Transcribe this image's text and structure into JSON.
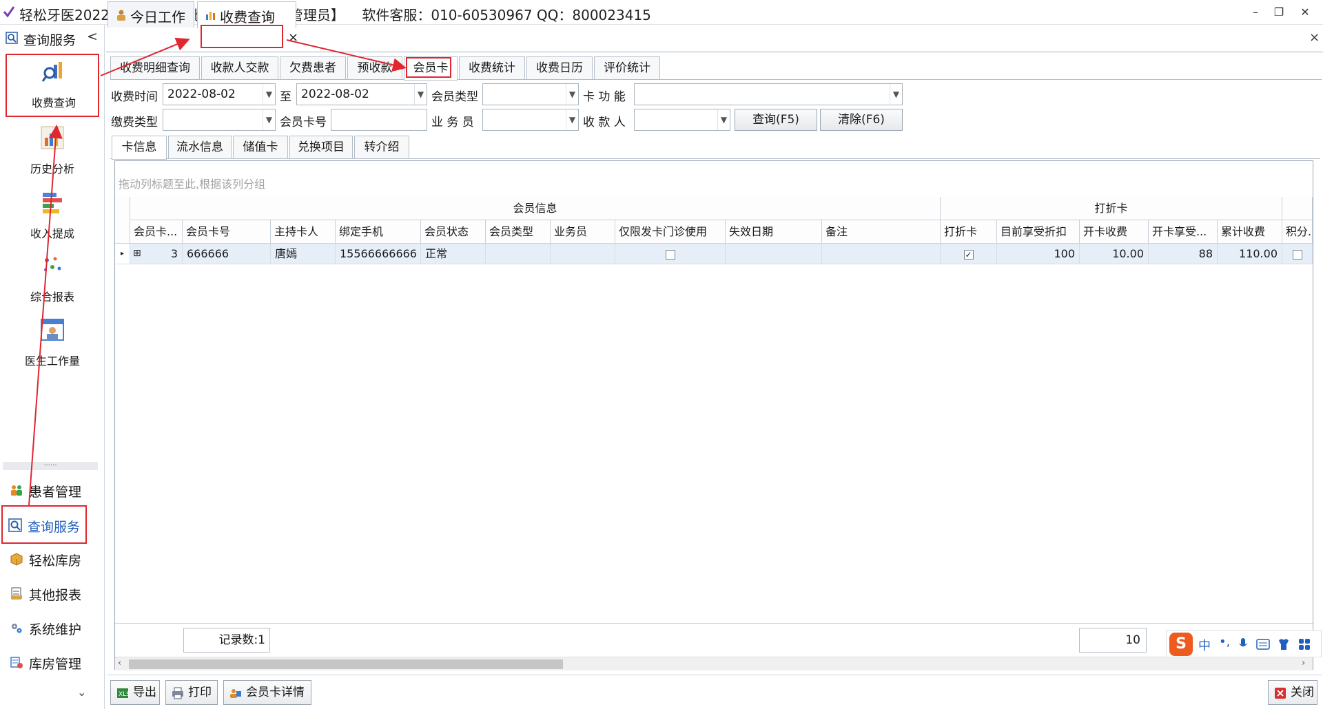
{
  "title_bar": {
    "title": "轻松牙医2022版S4专业版(北京轻松牙医)【管理员】    软件客服：010-60530967 QQ：800023415",
    "minimize": "–",
    "restore": "❐",
    "close": "✕"
  },
  "sidebar": {
    "header": "查询服务",
    "collapse": "<",
    "tools": [
      {
        "label": "收费查询",
        "icon": "magnifier-chart-icon"
      },
      {
        "label": "历史分析",
        "icon": "bar-chart-icon"
      },
      {
        "label": "收入提成",
        "icon": "stacked-bars-icon"
      },
      {
        "label": "综合报表",
        "icon": "dots-icon"
      },
      {
        "label": "医生工作量",
        "icon": "doctor-calendar-icon"
      }
    ],
    "divider": "......",
    "nav": [
      {
        "label": "患者管理",
        "icon": "people-icon"
      },
      {
        "label": "查询服务",
        "icon": "search-icon",
        "active": true
      },
      {
        "label": "轻松库房",
        "icon": "box-icon"
      },
      {
        "label": "其他报表",
        "icon": "report-icon"
      },
      {
        "label": "系统维护",
        "icon": "gears-icon"
      },
      {
        "label": "库房管理",
        "icon": "warehouse-icon"
      }
    ],
    "scroll_down": "⌄"
  },
  "doc_tabs": [
    {
      "label": "今日工作",
      "icon": "person-icon"
    },
    {
      "label": "收费查询",
      "icon": "chart-icon",
      "active": true
    }
  ],
  "doc_tab_close": "×",
  "doc_close_all": "×",
  "sub_tabs": [
    "收费明细查询",
    "收款人交款",
    "欠费患者",
    "预收款",
    "会员卡",
    "收费统计",
    "收费日历",
    "评价统计"
  ],
  "sub_tabs_active": "会员卡",
  "filters": {
    "date_label": "收费时间",
    "date_from": "2022-08-02",
    "to_label": "至",
    "date_to": "2022-08-02",
    "member_type_label": "会员类型",
    "member_type_value": "",
    "card_function_label": "卡 功 能",
    "card_function_value": "",
    "pay_type_label": "缴费类型",
    "pay_type_value": "",
    "card_no_label": "会员卡号",
    "card_no_value": "",
    "salesman_label": "业 务 员",
    "salesman_value": "",
    "receiver_label": "收 款 人",
    "receiver_value": "",
    "query_button": "查询(F5)",
    "clear_button": "清除(F6)"
  },
  "inner_tabs": [
    "卡信息",
    "流水信息",
    "储值卡",
    "兑换项目",
    "转介绍"
  ],
  "inner_tabs_active": "卡信息",
  "grid": {
    "group_hint": "拖动列标题至此,根据该列分组",
    "bands": [
      "会员信息",
      "打折卡"
    ],
    "columns": [
      "会员卡...",
      "会员卡号",
      "主持卡人",
      "绑定手机",
      "会员状态",
      "会员类型",
      "业务员",
      "仅限发卡门诊使用",
      "失效日期",
      "备注",
      "打折卡",
      "目前享受折扣",
      "开卡收费",
      "开卡享受...",
      "累计收费",
      "积分..."
    ],
    "rows": [
      {
        "count": "3",
        "card_no": "666666",
        "holder": "唐嫣",
        "phone": "15566666666",
        "status": "正常",
        "type": "",
        "salesman": "",
        "clinic_only": false,
        "expire": "",
        "note": "",
        "discount_card": true,
        "current_discount": "100",
        "open_fee": "10.00",
        "open_discount": "88",
        "total_fee": "110.00",
        "points": false
      }
    ],
    "record_count": "记录数:1",
    "footer_value": "10"
  },
  "bottom_toolbar": {
    "export": "导出",
    "print": "打印",
    "member_detail": "会员卡详情",
    "close": "关闭"
  },
  "ime": {
    "logo": "S",
    "mode": "中"
  },
  "colors": {
    "annotation_red": "#e0262f",
    "selected_row": "#e6eef7",
    "active_nav_text": "#1f5fbf"
  }
}
